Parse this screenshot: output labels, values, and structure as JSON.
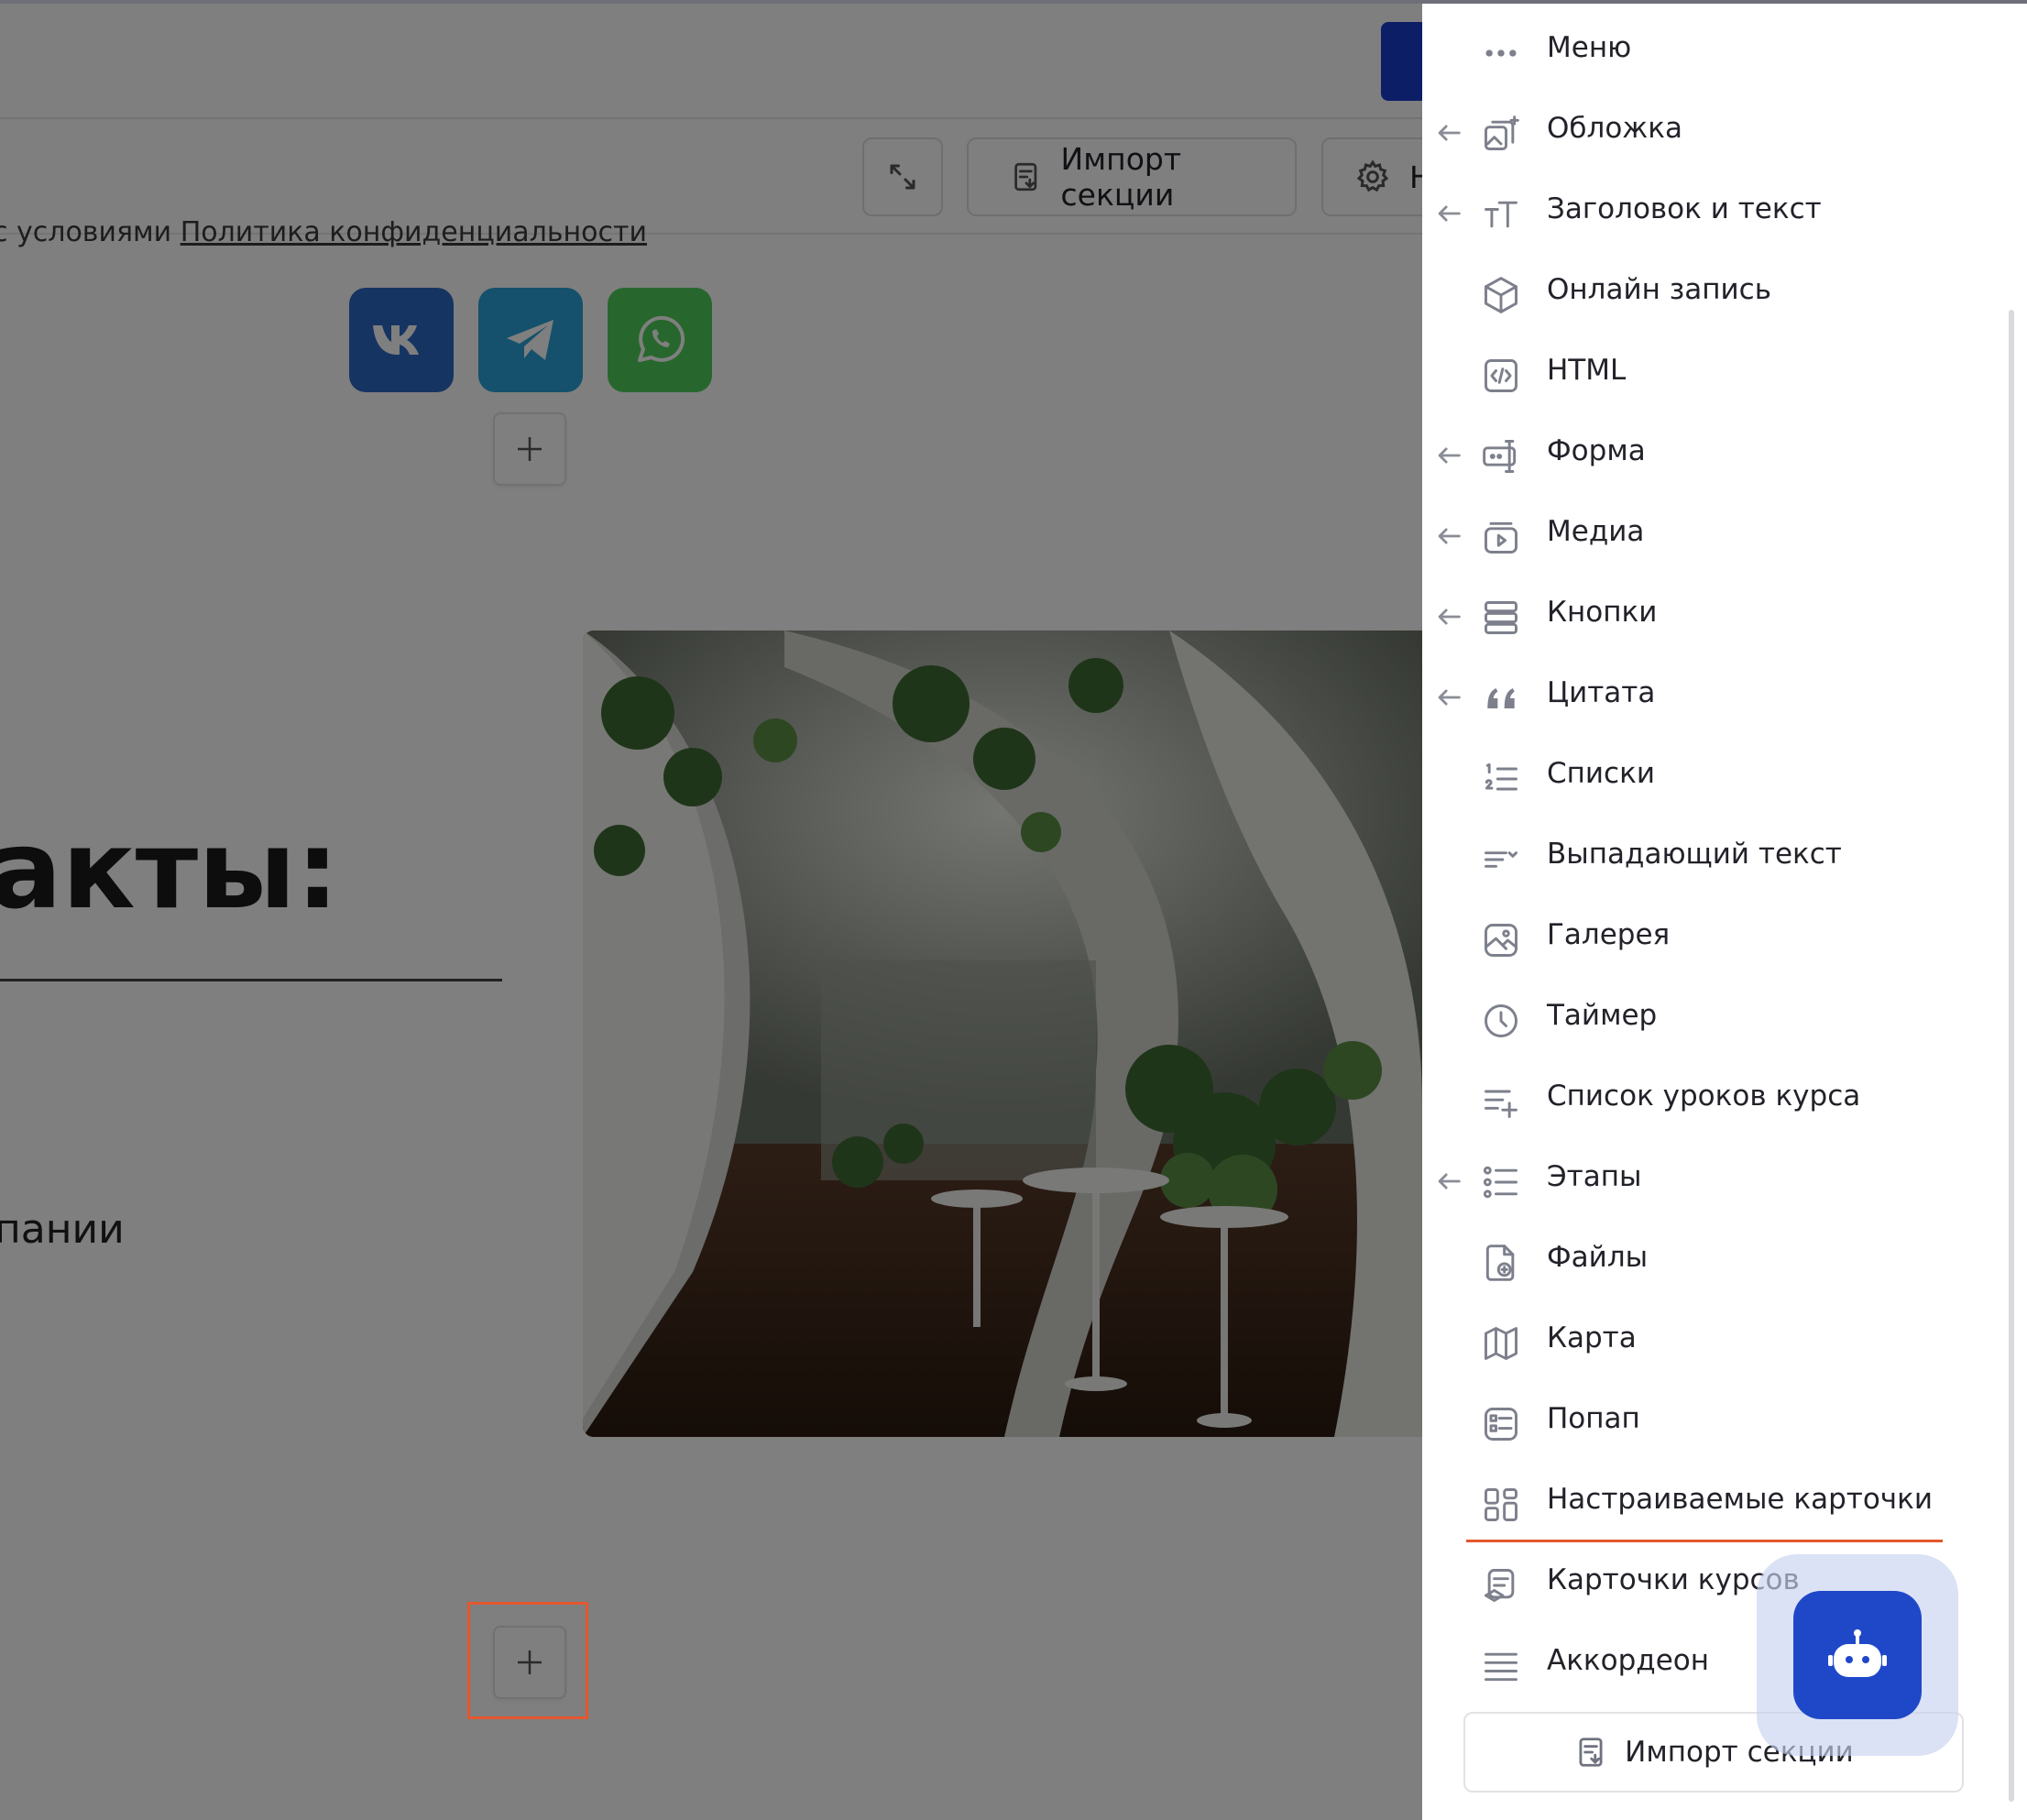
{
  "toolbar": {
    "expand_icon": "expand-icon",
    "import_label": "Импорт секции",
    "settings_label": "Н"
  },
  "page": {
    "privacy_prefix": "с условиями ",
    "privacy_link": "Политика конфиденциальности",
    "social_icons": [
      "vk-icon",
      "telegram-icon",
      "whatsapp-icon"
    ],
    "heading": "акты:",
    "subtext": "пании"
  },
  "panel": {
    "items": [
      {
        "label": "Меню",
        "icon": "menu-dots-icon",
        "has_arrow": false
      },
      {
        "label": "Обложка",
        "icon": "cover-icon",
        "has_arrow": true
      },
      {
        "label": "Заголовок и текст",
        "icon": "text-size-icon",
        "has_arrow": true
      },
      {
        "label": "Онлайн запись",
        "icon": "cube-icon",
        "has_arrow": false
      },
      {
        "label": "HTML",
        "icon": "html-code-icon",
        "has_arrow": false
      },
      {
        "label": "Форма",
        "icon": "form-icon",
        "has_arrow": true
      },
      {
        "label": "Медиа",
        "icon": "media-icon",
        "has_arrow": true
      },
      {
        "label": "Кнопки",
        "icon": "buttons-icon",
        "has_arrow": true
      },
      {
        "label": "Цитата",
        "icon": "quote-icon",
        "has_arrow": true
      },
      {
        "label": "Списки",
        "icon": "numbered-list-icon",
        "has_arrow": false
      },
      {
        "label": "Выпадающий текст",
        "icon": "dropdown-text-icon",
        "has_arrow": false
      },
      {
        "label": "Галерея",
        "icon": "gallery-icon",
        "has_arrow": false
      },
      {
        "label": "Таймер",
        "icon": "clock-icon",
        "has_arrow": false
      },
      {
        "label": "Список уроков курса",
        "icon": "lesson-list-icon",
        "has_arrow": false
      },
      {
        "label": "Этапы",
        "icon": "steps-icon",
        "has_arrow": true
      },
      {
        "label": "Файлы",
        "icon": "file-icon",
        "has_arrow": false
      },
      {
        "label": "Карта",
        "icon": "map-icon",
        "has_arrow": false
      },
      {
        "label": "Попап",
        "icon": "popup-icon",
        "has_arrow": false
      },
      {
        "label": "Настраиваемые карточки",
        "icon": "grid-cards-icon",
        "has_arrow": false
      },
      {
        "label": "Карточки курсов",
        "icon": "course-cards-icon",
        "has_arrow": false
      },
      {
        "label": "Аккордеон",
        "icon": "accordion-icon",
        "has_arrow": false
      }
    ],
    "import_label": "Импорт секции"
  },
  "colors": {
    "accent": "#1f48c9",
    "highlight": "#e4572e",
    "overlay": "rgba(0,0,0,0.5)",
    "vk": "#2b68c4",
    "telegram": "#2aa3d8",
    "whatsapp": "#4fcf5b"
  }
}
